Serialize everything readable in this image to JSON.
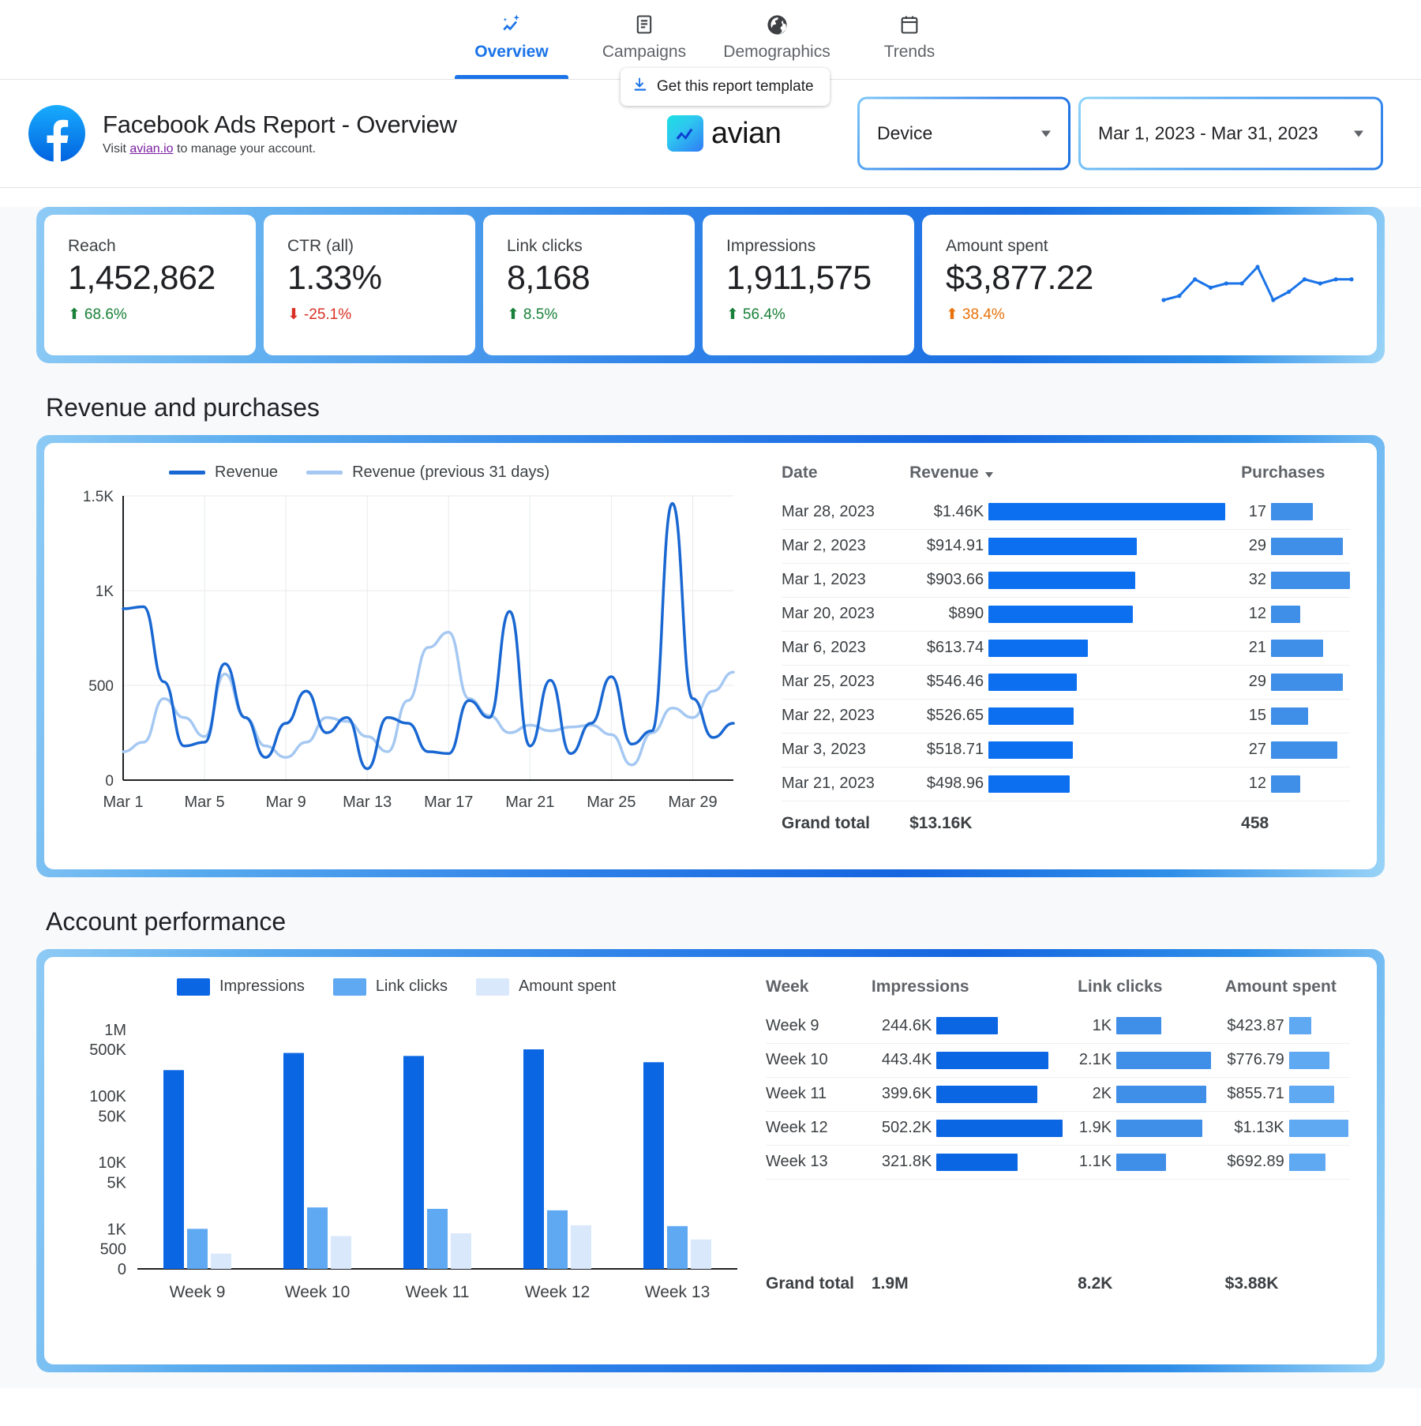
{
  "nav": {
    "items": [
      {
        "label": "Overview",
        "icon": "analytics-sparkle-icon",
        "active": true
      },
      {
        "label": "Campaigns",
        "icon": "document-icon",
        "active": false
      },
      {
        "label": "Demographics",
        "icon": "globe-icon",
        "active": false
      },
      {
        "label": "Trends",
        "icon": "calendar-icon",
        "active": false
      }
    ]
  },
  "header": {
    "title": "Facebook Ads Report - Overview",
    "subtitle_before": "Visit ",
    "subtitle_link": "avian.io",
    "subtitle_after": " to manage your account.",
    "brand": "avian",
    "template_button": "Get this report template",
    "device_filter": "Device",
    "date_range": "Mar 1, 2023 - Mar 31, 2023",
    "accent": "#1a73e8"
  },
  "scorecards": [
    {
      "label": "Reach",
      "value": "1,452,862",
      "delta": "68.6%",
      "dir": "up",
      "tone": "up"
    },
    {
      "label": "CTR (all)",
      "value": "1.33%",
      "delta": "-25.1%",
      "dir": "down",
      "tone": "down"
    },
    {
      "label": "Link clicks",
      "value": "8,168",
      "delta": "8.5%",
      "dir": "up",
      "tone": "up"
    },
    {
      "label": "Impressions",
      "value": "1,911,575",
      "delta": "56.4%",
      "dir": "up",
      "tone": "up"
    },
    {
      "label": "Amount spent",
      "value": "$3,877.22",
      "delta": "38.4%",
      "dir": "up",
      "tone": "warn"
    }
  ],
  "sections": {
    "revenue_title": "Revenue and purchases",
    "performance_title": "Account performance"
  },
  "revenue_table": {
    "columns": [
      "Date",
      "Revenue",
      "Purchases"
    ],
    "sorted_by": "Revenue",
    "rows": [
      {
        "date": "Mar 28, 2023",
        "revenue": "$1.46K",
        "revenue_num": 1460,
        "purchases": "17",
        "purchases_num": 17
      },
      {
        "date": "Mar 2, 2023",
        "revenue": "$914.91",
        "revenue_num": 914.91,
        "purchases": "29",
        "purchases_num": 29
      },
      {
        "date": "Mar 1, 2023",
        "revenue": "$903.66",
        "revenue_num": 903.66,
        "purchases": "32",
        "purchases_num": 32
      },
      {
        "date": "Mar 20, 2023",
        "revenue": "$890",
        "revenue_num": 890,
        "purchases": "12",
        "purchases_num": 12
      },
      {
        "date": "Mar 6, 2023",
        "revenue": "$613.74",
        "revenue_num": 613.74,
        "purchases": "21",
        "purchases_num": 21
      },
      {
        "date": "Mar 25, 2023",
        "revenue": "$546.46",
        "revenue_num": 546.46,
        "purchases": "29",
        "purchases_num": 29
      },
      {
        "date": "Mar 22, 2023",
        "revenue": "$526.65",
        "revenue_num": 526.65,
        "purchases": "15",
        "purchases_num": 15
      },
      {
        "date": "Mar 3, 2023",
        "revenue": "$518.71",
        "revenue_num": 518.71,
        "purchases": "27",
        "purchases_num": 27
      },
      {
        "date": "Mar 21, 2023",
        "revenue": "$498.96",
        "revenue_num": 498.96,
        "purchases": "12",
        "purchases_num": 12
      }
    ],
    "grand_total_label": "Grand total",
    "grand_total_revenue": "$13.16K",
    "grand_total_purchases": "458"
  },
  "performance_table": {
    "columns": [
      "Week",
      "Impressions",
      "Link clicks",
      "Amount spent"
    ],
    "rows": [
      {
        "week": "Week 9",
        "impressions": "244.6K",
        "impressions_num": 244600,
        "clicks": "1K",
        "clicks_num": 1000,
        "spent": "$423.87",
        "spent_num": 423.87
      },
      {
        "week": "Week 10",
        "impressions": "443.4K",
        "impressions_num": 443400,
        "clicks": "2.1K",
        "clicks_num": 2100,
        "spent": "$776.79",
        "spent_num": 776.79
      },
      {
        "week": "Week 11",
        "impressions": "399.6K",
        "impressions_num": 399600,
        "clicks": "2K",
        "clicks_num": 2000,
        "spent": "$855.71",
        "spent_num": 855.71
      },
      {
        "week": "Week 12",
        "impressions": "502.2K",
        "impressions_num": 502200,
        "clicks": "1.9K",
        "clicks_num": 1900,
        "spent": "$1.13K",
        "spent_num": 1130
      },
      {
        "week": "Week 13",
        "impressions": "321.8K",
        "impressions_num": 321800,
        "clicks": "1.1K",
        "clicks_num": 1100,
        "spent": "$692.89",
        "spent_num": 692.89
      }
    ],
    "grand_total_label": "Grand total",
    "grand_total_impressions": "1.9M",
    "grand_total_clicks": "8.2K",
    "grand_total_spent": "$3.88K"
  },
  "chart_data": [
    {
      "type": "line",
      "title": "Revenue and purchases",
      "xlabel": "",
      "ylabel": "",
      "ylim": [
        0,
        1500
      ],
      "yticks": [
        "0",
        "500",
        "1K",
        "1.5K"
      ],
      "xticks": [
        "Mar 1",
        "Mar 5",
        "Mar 9",
        "Mar 13",
        "Mar 17",
        "Mar 21",
        "Mar 25",
        "Mar 29"
      ],
      "grid": true,
      "legend_position": "top-left",
      "x": [
        "Mar 1",
        "Mar 2",
        "Mar 3",
        "Mar 4",
        "Mar 5",
        "Mar 6",
        "Mar 7",
        "Mar 8",
        "Mar 9",
        "Mar 10",
        "Mar 11",
        "Mar 12",
        "Mar 13",
        "Mar 14",
        "Mar 15",
        "Mar 16",
        "Mar 17",
        "Mar 18",
        "Mar 19",
        "Mar 20",
        "Mar 21",
        "Mar 22",
        "Mar 23",
        "Mar 24",
        "Mar 25",
        "Mar 26",
        "Mar 27",
        "Mar 28",
        "Mar 29",
        "Mar 30",
        "Mar 31"
      ],
      "series": [
        {
          "name": "Revenue",
          "color": "#1967d2",
          "values": [
            904,
            915,
            519,
            180,
            200,
            614,
            330,
            120,
            300,
            470,
            250,
            330,
            60,
            330,
            300,
            150,
            140,
            420,
            330,
            890,
            180,
            527,
            140,
            300,
            546,
            190,
            260,
            1460,
            430,
            225,
            300
          ]
        },
        {
          "name": "Revenue (previous 31 days)",
          "color": "#a5c8f2",
          "values": [
            150,
            200,
            430,
            330,
            230,
            560,
            330,
            180,
            120,
            200,
            330,
            310,
            230,
            150,
            420,
            700,
            780,
            430,
            340,
            250,
            290,
            260,
            280,
            290,
            240,
            80,
            250,
            380,
            330,
            470,
            570
          ]
        }
      ]
    },
    {
      "type": "bar",
      "title": "Account performance",
      "xlabel": "",
      "ylabel": "",
      "log_scale": true,
      "yticks": [
        "0",
        "500",
        "1K",
        "5K",
        "10K",
        "50K",
        "100K",
        "500K",
        "1M"
      ],
      "categories": [
        "Week 9",
        "Week 10",
        "Week 11",
        "Week 12",
        "Week 13"
      ],
      "legend_position": "top",
      "series": [
        {
          "name": "Impressions",
          "color": "#0b66e4",
          "values": [
            244600,
            443400,
            399600,
            502200,
            321800
          ]
        },
        {
          "name": "Link clicks",
          "color": "#5fa8f2",
          "values": [
            1000,
            2100,
            2000,
            1900,
            1100
          ]
        },
        {
          "name": "Amount spent",
          "color": "#d9e8fb",
          "values": [
            423.87,
            776.79,
            855.71,
            1130,
            692.89
          ]
        }
      ]
    },
    {
      "type": "line",
      "title": "Amount spent sparkline",
      "color": "#1a73e8",
      "values": [
        4,
        5,
        9,
        7,
        8,
        8,
        12,
        4,
        6,
        9,
        8,
        9,
        9
      ]
    }
  ]
}
